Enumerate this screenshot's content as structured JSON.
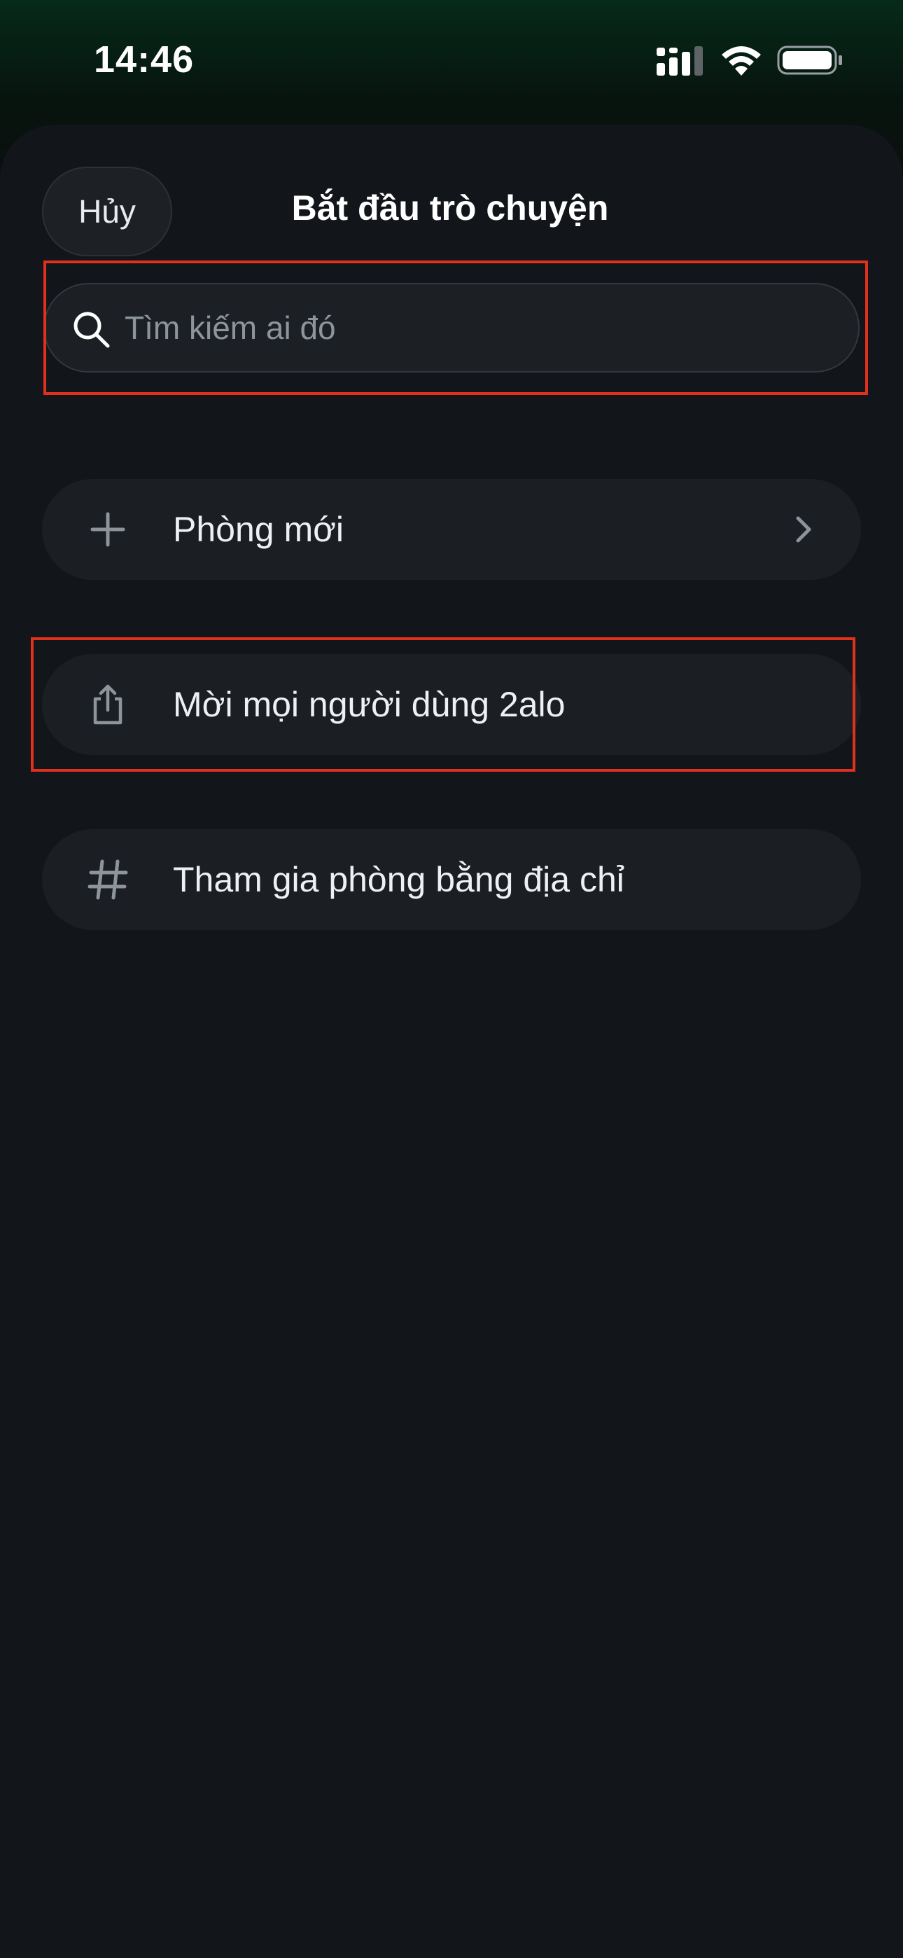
{
  "status_bar": {
    "time": "14:46",
    "icons": [
      "cellular-signal-icon",
      "wifi-icon",
      "battery-icon"
    ]
  },
  "header": {
    "cancel_label": "Hủy",
    "title": "Bắt đầu trò chuyện"
  },
  "search": {
    "placeholder": "Tìm kiếm ai đó",
    "value": "",
    "icon": "search-icon"
  },
  "menu": {
    "items": [
      {
        "icon": "plus-icon",
        "label": "Phòng mới",
        "trailing_icon": "chevron-right-icon"
      },
      {
        "icon": "share-icon",
        "label": "Mời mọi người dùng 2alo"
      },
      {
        "icon": "hash-icon",
        "label": "Tham gia phòng bằng địa chỉ"
      }
    ]
  },
  "colors": {
    "background": "#101216",
    "sheet": "#121519",
    "row_background": "#1b1e23",
    "highlight": "#e0301e",
    "icon_muted": "#8d949b",
    "top_gradient": "#062a19"
  }
}
